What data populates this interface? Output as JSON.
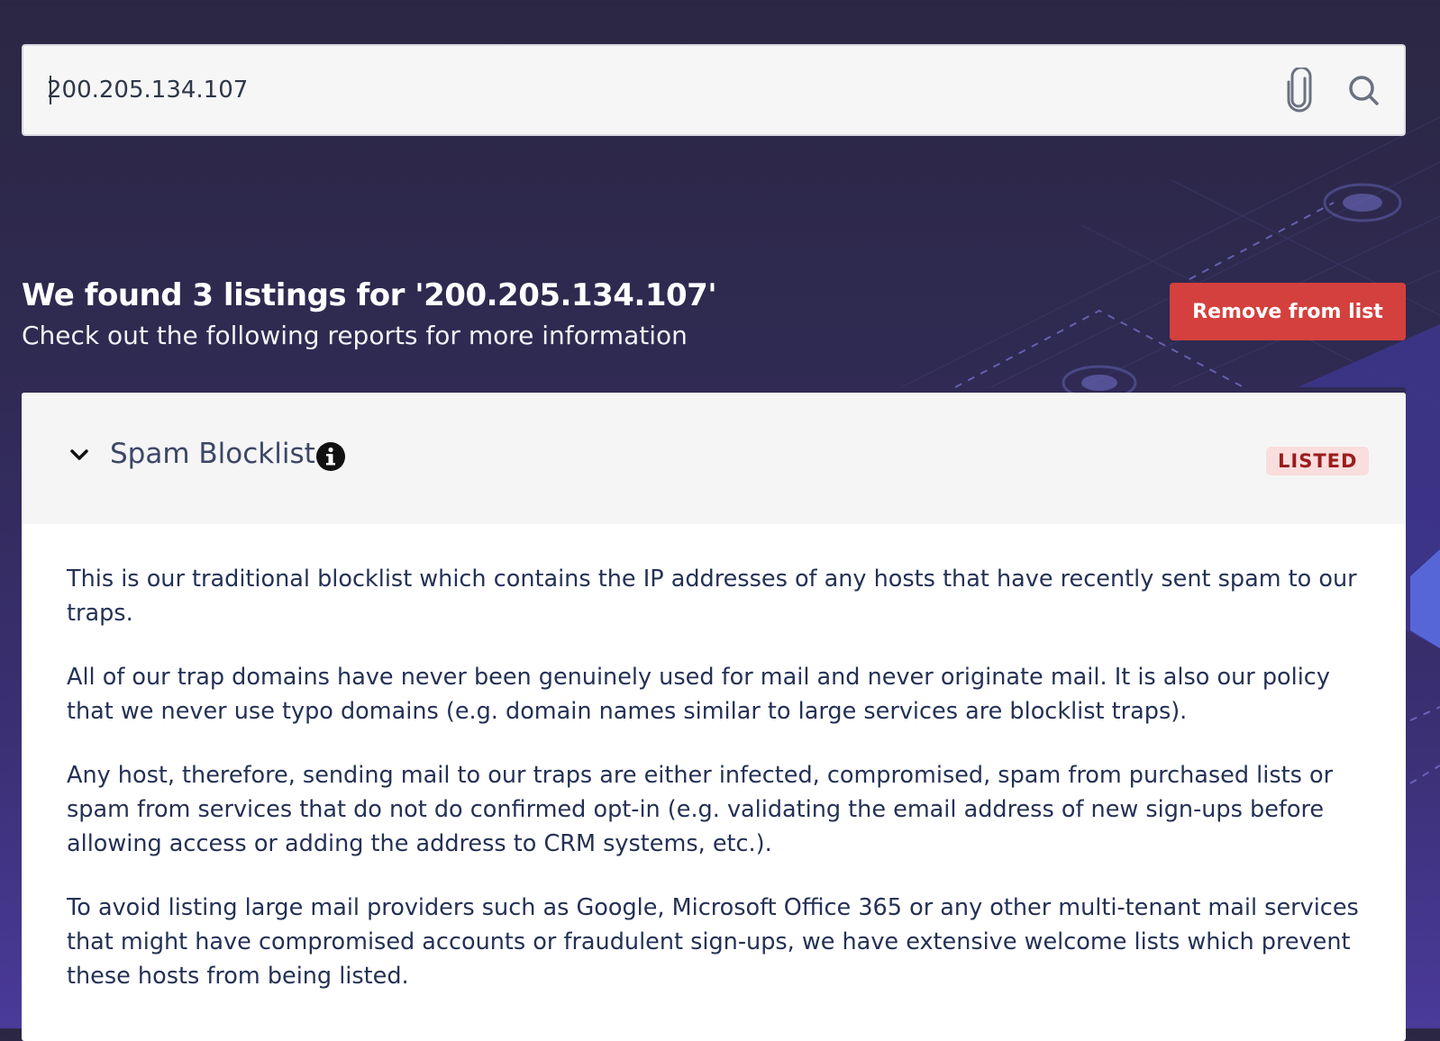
{
  "search": {
    "value": "200.205.134.107",
    "attach_icon": "paperclip-icon",
    "search_icon": "search-icon"
  },
  "results": {
    "title": "We found 3 listings for '200.205.134.107'",
    "subtitle": "Check out the following reports for more information",
    "remove_label": "Remove from list"
  },
  "card": {
    "title": "Spam Blocklist",
    "chevron_icon": "chevron-down-icon",
    "info_icon": "info-icon",
    "status": "LISTED",
    "paragraphs": [
      "This is our traditional blocklist which contains the IP addresses of any hosts that have recently sent spam to our traps.",
      "All of our trap domains have never been genuinely used for mail and never originate mail. It is also our policy that we never use typo domains (e.g. domain names similar to large services are blocklist traps).",
      "Any host, therefore, sending mail to our traps are either infected, compromised, spam from purchased lists or spam from services that do not do confirmed opt-in (e.g. validating the email address of new sign-ups before allowing access or adding the address to CRM systems, etc.).",
      "To avoid listing large mail providers such as Google, Microsoft Office 365 or any other multi-tenant mail services that might have compromised accounts or fraudulent sign-ups, we have extensive welcome lists which prevent these hosts from being listed."
    ]
  },
  "colors": {
    "background": "#2b2743",
    "accent_red": "#d4403d",
    "badge_bg": "#fadddd",
    "badge_text": "#9b1c1c",
    "text": "#243155"
  }
}
